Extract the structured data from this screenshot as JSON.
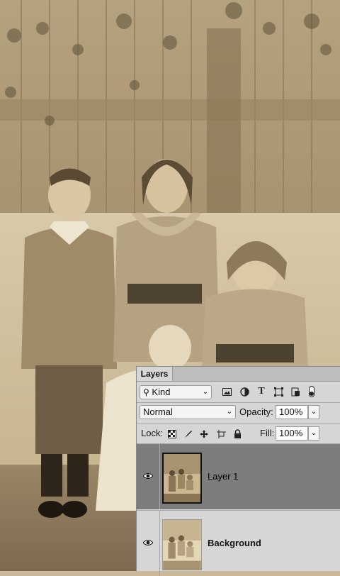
{
  "panel": {
    "tab_label": "Layers",
    "filter": {
      "kind_label": "Kind",
      "icons": [
        "search-icon",
        "image-filter-icon",
        "adjustment-filter-icon",
        "type-filter-icon",
        "shape-filter-icon",
        "smart-object-filter-icon",
        "filter-toggle-icon"
      ]
    },
    "blend": {
      "mode_value": "Normal",
      "opacity_label": "Opacity:",
      "opacity_value": "100%"
    },
    "lock": {
      "lock_label": "Lock:",
      "icons": [
        "lock-transparent-pixels-icon",
        "lock-image-pixels-icon",
        "lock-position-icon",
        "lock-artboard-icon",
        "lock-all-icon"
      ],
      "fill_label": "Fill:",
      "fill_value": "100%"
    },
    "layers": [
      {
        "name": "Layer 1",
        "visible": true,
        "selected": true
      },
      {
        "name": "Background",
        "visible": true,
        "selected": false
      }
    ]
  },
  "colors": {
    "panel_bg": "#d6d6d6",
    "selected_layer": "#7d7d7d",
    "photo_sepia": "#c9b89a"
  }
}
